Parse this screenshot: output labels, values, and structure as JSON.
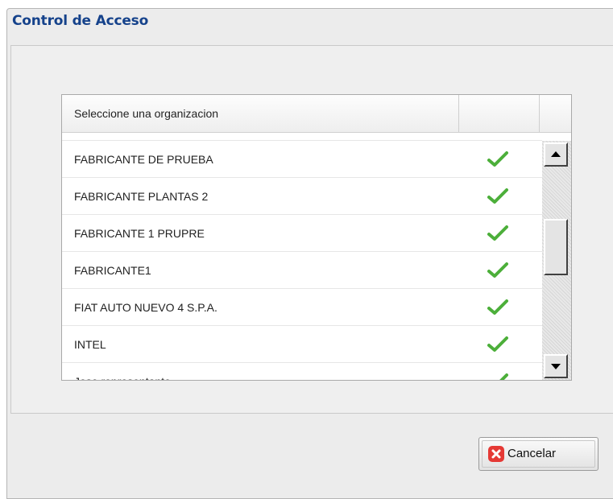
{
  "window": {
    "title": "Control de Acceso"
  },
  "grid": {
    "header": {
      "name_label": "Seleccione una organizacion"
    },
    "rows": [
      {
        "name": "FABRICANTE DE PRUEBA",
        "selected_icon": "check-icon"
      },
      {
        "name": "FABRICANTE PLANTAS 2",
        "selected_icon": "check-icon"
      },
      {
        "name": "FABRICANTE 1 PRUPRE",
        "selected_icon": "check-icon"
      },
      {
        "name": "FABRICANTE1",
        "selected_icon": "check-icon"
      },
      {
        "name": "FIAT AUTO NUEVO 4 S.P.A.",
        "selected_icon": "check-icon"
      },
      {
        "name": "INTEL",
        "selected_icon": "check-icon"
      },
      {
        "name": "Jose representante",
        "selected_icon": "check-icon"
      }
    ],
    "scroll_icons": {
      "up": "scroll-up-arrow-icon",
      "down": "scroll-down-arrow-icon"
    }
  },
  "footer": {
    "cancel_label": "Cancelar",
    "cancel_icon": "cancel-x-icon"
  },
  "colors": {
    "title": "#15428b",
    "check": "#4caf3a",
    "cancel_icon": "#e53935"
  }
}
